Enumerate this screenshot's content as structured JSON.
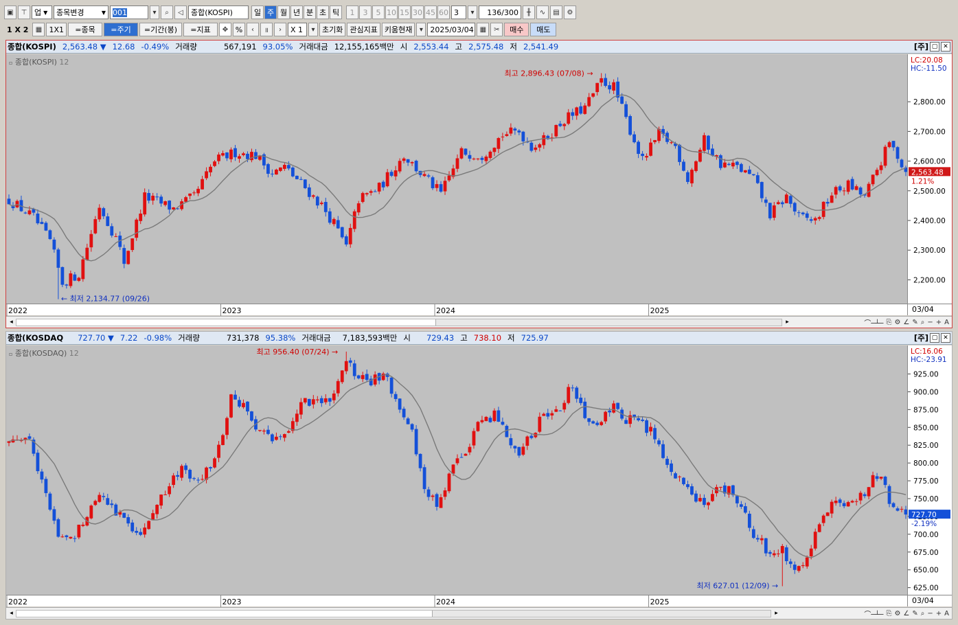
{
  "toolbar1": {
    "market_select": "업",
    "stock_change": "종목변경",
    "code_input": "001",
    "name_input": "종합(KOSPI)",
    "periods": [
      "일",
      "주",
      "월",
      "년",
      "분",
      "초",
      "틱"
    ],
    "selected_period": "주",
    "minutes": [
      "1",
      "3",
      "5",
      "10",
      "15",
      "30",
      "45",
      "60"
    ],
    "min_select": "3",
    "count_input": "136",
    "count_total": "/300"
  },
  "toolbar2": {
    "layout_label": "1 X 2",
    "one_by_one": "1X1",
    "btn_stock": "=종목",
    "btn_period": "=주기",
    "btn_range": "=기간(봉)",
    "btn_indicator": "=지표",
    "pct": "%",
    "scale": "X 1",
    "btn_reset": "초기화",
    "btn_watch": "관심지표",
    "btn_kiwoom": "키움현재",
    "date_input": "2025/03/04",
    "btn_buy": "매수",
    "btn_sell": "매도"
  },
  "colors": {
    "up": "#e01010",
    "down": "#1450d8",
    "ma": "#7a7a7a",
    "bg": "#c0c0c0"
  },
  "kospi": {
    "name": "종합(KOSPI)",
    "price": "2,563.48",
    "arrow": "▼",
    "change": "12.68",
    "change_pct": "-0.49%",
    "vol_label": "거래량",
    "vol": "567,191",
    "vol_pct": "93.05%",
    "amt_label": "거래대금",
    "amt": "12,155,165백만",
    "open_label": "시",
    "open": "2,553.44",
    "high_label": "고",
    "high": "2,575.48",
    "low_label": "저",
    "low": "2,541.49",
    "corner": "[주]",
    "series_label": "종합(KOSPI)",
    "ma_period": "12",
    "lc": "LC:20.08",
    "hc": "HC:-11.50",
    "max_label": "최고 2,896.43 (07/08)",
    "min_label": "최저 2,134.77 (09/26)",
    "price_tag": "2,563.48",
    "price_tag_pct": "1.21%",
    "date_tag": "03/04"
  },
  "kosdaq": {
    "name": "종합(KOSDAQ",
    "price": "727.70",
    "arrow": "▼",
    "change": "7.22",
    "change_pct": "-0.98%",
    "vol_label": "거래량",
    "vol": "731,378",
    "vol_pct": "95.38%",
    "amt_label": "거래대금",
    "amt": "7,183,593백만",
    "open_label": "시",
    "open": "729.43",
    "high_label": "고",
    "high": "738.10",
    "low_label": "저",
    "low": "725.97",
    "corner": "[주]",
    "series_label": "종합(KOSDAQ)",
    "ma_period": "12",
    "lc": "LC:16.06",
    "hc": "HC:-23.91",
    "max_label": "최고 956.40 (07/24)",
    "min_label": "최저 627.01 (12/09)",
    "price_tag": "727.70",
    "price_tag_pct": "-2.19%",
    "date_tag": "03/04"
  },
  "chart_data": [
    {
      "type": "candlestick",
      "title": "종합(KOSPI)",
      "interval": "weekly",
      "x_ticks": [
        "2022",
        "2023",
        "2024",
        "2025"
      ],
      "y_ticks": [
        "2,200.00",
        "2,300.00",
        "2,400.00",
        "2,500.00",
        "2,600.00",
        "2,700.00",
        "2,800.00"
      ],
      "ylim": [
        2120,
        2960
      ],
      "ma_period": 12,
      "anchors": [
        [
          0,
          2470
        ],
        [
          6,
          2410
        ],
        [
          10,
          2330
        ],
        [
          13,
          2190
        ],
        [
          17,
          2220
        ],
        [
          22,
          2450
        ],
        [
          26,
          2340
        ],
        [
          28,
          2260
        ],
        [
          33,
          2480
        ],
        [
          40,
          2440
        ],
        [
          45,
          2480
        ],
        [
          50,
          2600
        ],
        [
          55,
          2630
        ],
        [
          60,
          2620
        ],
        [
          64,
          2560
        ],
        [
          67,
          2580
        ],
        [
          72,
          2510
        ],
        [
          76,
          2450
        ],
        [
          79,
          2390
        ],
        [
          82,
          2310
        ],
        [
          85,
          2470
        ],
        [
          90,
          2510
        ],
        [
          96,
          2620
        ],
        [
          100,
          2560
        ],
        [
          105,
          2490
        ],
        [
          110,
          2630
        ],
        [
          115,
          2620
        ],
        [
          120,
          2690
        ],
        [
          124,
          2700
        ],
        [
          127,
          2650
        ],
        [
          130,
          2670
        ],
        [
          135,
          2740
        ],
        [
          140,
          2780
        ],
        [
          144,
          2870
        ],
        [
          147,
          2850
        ],
        [
          150,
          2740
        ],
        [
          154,
          2600
        ],
        [
          158,
          2690
        ],
        [
          162,
          2650
        ],
        [
          165,
          2540
        ],
        [
          169,
          2670
        ],
        [
          173,
          2590
        ],
        [
          177,
          2580
        ],
        [
          181,
          2540
        ],
        [
          185,
          2420
        ],
        [
          189,
          2480
        ],
        [
          192,
          2410
        ],
        [
          196,
          2400
        ],
        [
          200,
          2490
        ],
        [
          204,
          2520
        ],
        [
          208,
          2480
        ],
        [
          212,
          2600
        ],
        [
          214,
          2660
        ],
        [
          216,
          2620
        ],
        [
          218,
          2563
        ]
      ],
      "max": {
        "label": "최고 2,896.43 (07/08)",
        "value": 2896.43
      },
      "min": {
        "label": "최저 2,134.77 (09/26)",
        "value": 2134.77
      },
      "last": 2563.48
    },
    {
      "type": "candlestick",
      "title": "종합(KOSDAQ)",
      "interval": "weekly",
      "x_ticks": [
        "2022",
        "2023",
        "2024",
        "2025"
      ],
      "y_ticks": [
        "625.00",
        "650.00",
        "675.00",
        "700.00",
        "725.00",
        "750.00",
        "775.00",
        "800.00",
        "825.00",
        "850.00",
        "875.00",
        "900.00",
        "925.00"
      ],
      "ylim": [
        615,
        965
      ],
      "ma_period": 12,
      "anchors": [
        [
          0,
          830
        ],
        [
          5,
          840
        ],
        [
          8,
          770
        ],
        [
          12,
          700
        ],
        [
          15,
          690
        ],
        [
          18,
          720
        ],
        [
          22,
          760
        ],
        [
          25,
          740
        ],
        [
          28,
          720
        ],
        [
          31,
          700
        ],
        [
          34,
          720
        ],
        [
          38,
          760
        ],
        [
          42,
          790
        ],
        [
          46,
          780
        ],
        [
          50,
          800
        ],
        [
          54,
          890
        ],
        [
          57,
          880
        ],
        [
          60,
          850
        ],
        [
          64,
          830
        ],
        [
          68,
          850
        ],
        [
          72,
          890
        ],
        [
          76,
          880
        ],
        [
          79,
          900
        ],
        [
          82,
          940
        ],
        [
          85,
          920
        ],
        [
          88,
          910
        ],
        [
          91,
          930
        ],
        [
          95,
          880
        ],
        [
          98,
          840
        ],
        [
          101,
          760
        ],
        [
          104,
          740
        ],
        [
          107,
          780
        ],
        [
          110,
          810
        ],
        [
          114,
          850
        ],
        [
          118,
          870
        ],
        [
          121,
          840
        ],
        [
          124,
          810
        ],
        [
          127,
          840
        ],
        [
          130,
          870
        ],
        [
          134,
          880
        ],
        [
          137,
          910
        ],
        [
          140,
          860
        ],
        [
          144,
          860
        ],
        [
          147,
          880
        ],
        [
          150,
          860
        ],
        [
          153,
          860
        ],
        [
          157,
          840
        ],
        [
          160,
          790
        ],
        [
          163,
          780
        ],
        [
          166,
          750
        ],
        [
          169,
          740
        ],
        [
          172,
          770
        ],
        [
          175,
          760
        ],
        [
          178,
          740
        ],
        [
          181,
          700
        ],
        [
          184,
          680
        ],
        [
          188,
          680
        ],
        [
          191,
          650
        ],
        [
          194,
          670
        ],
        [
          196,
          705
        ],
        [
          200,
          740
        ],
        [
          204,
          740
        ],
        [
          208,
          760
        ],
        [
          211,
          785
        ],
        [
          214,
          750
        ],
        [
          218,
          727
        ]
      ],
      "max": {
        "label": "최고 956.40 (07/24)",
        "value": 956.4
      },
      "min": {
        "label": "최저 627.01 (12/09)",
        "value": 627.01
      },
      "last": 727.7
    }
  ]
}
